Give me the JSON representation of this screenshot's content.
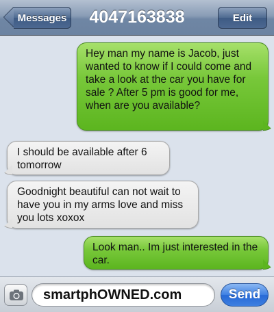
{
  "header": {
    "back_label": "Messages",
    "title": "4047163838",
    "edit_label": "Edit"
  },
  "messages": [
    {
      "direction": "sent",
      "text": "Hey man my name is Jacob, just wanted to know if I could come and take a look at the car you have for sale ? After 5 pm is good for me, when are you available?"
    },
    {
      "direction": "received",
      "text": "I should be available after 6 tomorrow"
    },
    {
      "direction": "received",
      "text": "Goodnight beautiful can not wait to have you in my arms love and miss you lots xoxox"
    },
    {
      "direction": "sent",
      "text": "Look man.. Im just interested in the car."
    }
  ],
  "composer": {
    "camera_icon": "camera-icon",
    "input_value": "smartphOWNED.com",
    "send_label": "Send"
  },
  "colors": {
    "sent_bubble": "#78c83a",
    "received_bubble": "#e6e6e6",
    "background": "#dbe2ec",
    "send_button": "#3f80e3"
  }
}
